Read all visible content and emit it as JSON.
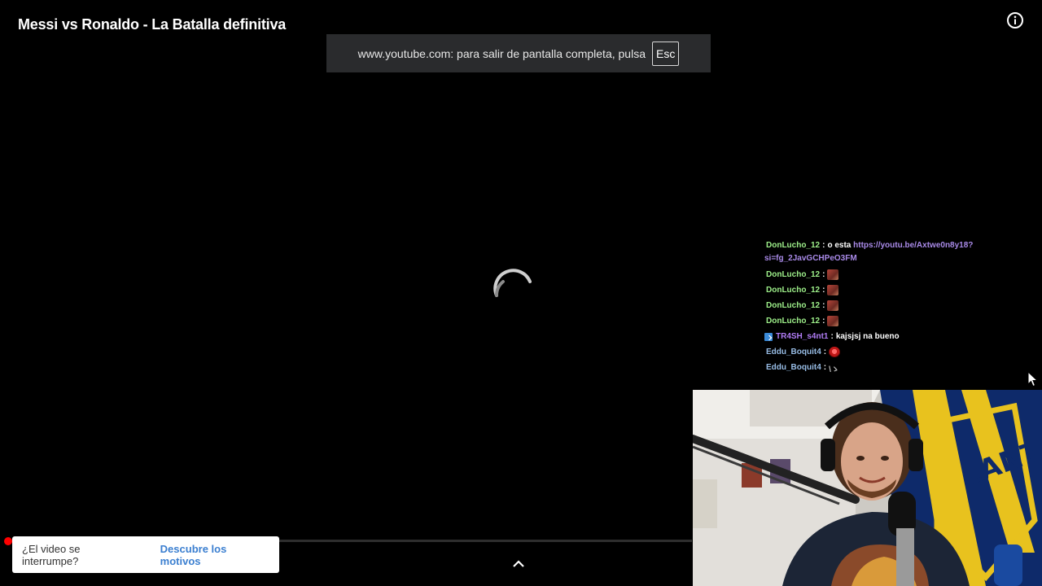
{
  "player": {
    "title": "Messi vs Ronaldo - La Batalla definitiva",
    "info_icon": "info-icon",
    "progress_fraction": 0.0,
    "progress_color": "#ff0000",
    "loading": true
  },
  "fullscreen_toast": {
    "message": "www.youtube.com: para salir de pantalla completa, pulsa",
    "key": "Esc"
  },
  "chat": {
    "messages": [
      {
        "user": "DonLucho_12",
        "sep": ":",
        "text": "o esta",
        "link": "https://youtu.be/Axtwe0n8y18?si=fg_2JavGCHPeO3FM",
        "user_color": "#9ef08a"
      },
      {
        "user": "DonLucho_12",
        "sep": ":",
        "emote": "rock-emote",
        "user_color": "#9ef08a"
      },
      {
        "user": "DonLucho_12",
        "sep": ":",
        "emote": "rock-emote",
        "user_color": "#9ef08a"
      },
      {
        "user": "DonLucho_12",
        "sep": ":",
        "emote": "rock-emote",
        "user_color": "#9ef08a"
      },
      {
        "user": "DonLucho_12",
        "sep": ":",
        "emote": "rock-emote",
        "user_color": "#9ef08a"
      },
      {
        "user": "TR4SH_s4nt1",
        "sep": ":",
        "text": "kajsjsj na bueno",
        "badge": "prime-badge",
        "user_color": "#b07cf5"
      },
      {
        "user": "Eddu_Boquit4",
        "sep": ":",
        "emote": "shield-emote",
        "user_color": "#98bde6"
      },
      {
        "user": "Eddu_Boquit4",
        "sep": ":",
        "emote_text": "\\ゝ",
        "user_color": "#98bde6"
      }
    ]
  },
  "webcam": {
    "flag_text": "LANTA"
  },
  "interrupt_card": {
    "question": "¿El video se interrumpe?",
    "link": "Descubre los motivos"
  },
  "controls": {
    "expand_icon": "chevron-up-icon"
  }
}
